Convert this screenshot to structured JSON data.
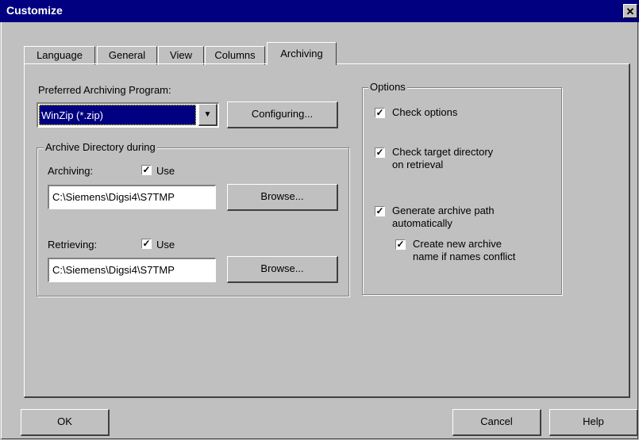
{
  "window": {
    "title": "Customize",
    "close_label": "✕"
  },
  "tabs": [
    "Language",
    "General",
    "View",
    "Columns",
    "Archiving"
  ],
  "active_tab": "Archiving",
  "archiving": {
    "preferred_label": "Preferred Archiving Program:",
    "preferred_value": "WinZip (*.zip)",
    "configuring_button": "Configuring...",
    "archive_dir_group": "Archive Directory during",
    "archiving_label": "Archiving:",
    "archiving_use_label": "Use",
    "archiving_use_checked": true,
    "archiving_path": "C:\\Siemens\\Digsi4\\S7TMP",
    "browse_button_1": "Browse...",
    "retrieving_label": "Retrieving:",
    "retrieving_use_label": "Use",
    "retrieving_use_checked": true,
    "retrieving_path": "C:\\Siemens\\Digsi4\\S7TMP",
    "browse_button_2": "Browse..."
  },
  "options": {
    "group_label": "Options",
    "check_options": "Check options",
    "check_target_line1": "Check target directory",
    "check_target_line2": "on retrieval",
    "generate_path_line1": "Generate archive path",
    "generate_path_line2": "automatically",
    "create_new_line1": "Create new archive",
    "create_new_line2": "name if names conflict"
  },
  "footer": {
    "ok": "OK",
    "cancel": "Cancel",
    "help": "Help"
  }
}
